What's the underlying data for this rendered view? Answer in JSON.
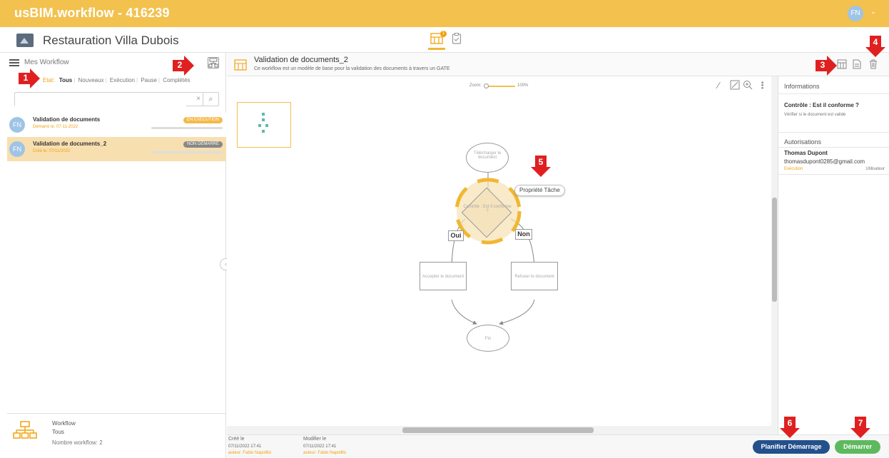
{
  "app": {
    "title": "usBIM.workflow - 416239",
    "user_initials": "FN",
    "user_chevron": "⌄"
  },
  "project": {
    "title": "Restauration Villa Dubois",
    "tabs": [
      {
        "icon": "workflow-tab-icon",
        "badge": "1",
        "active": true
      },
      {
        "icon": "clipboard-tab-icon",
        "active": false
      }
    ]
  },
  "sidebar": {
    "title": "Mes Workflow",
    "filter_state_label": "Etat:",
    "filters": [
      "Tous",
      "Nouveaux",
      "Exécution",
      "Pause",
      "Complétés"
    ],
    "active_filter": "Tous",
    "search": {
      "value": "",
      "placeholder": ""
    },
    "items": [
      {
        "initials": "FN",
        "name": "Validation de documents",
        "date": "Démarré le: 07-11-2022",
        "status": "EN EXÉCUTION",
        "selected": false
      },
      {
        "initials": "FN",
        "name": "Validation de documents_2",
        "date": "Créé le: 07/11/2022",
        "status": "NON DÉMARRÉ",
        "selected": true
      }
    ],
    "footer": {
      "line1": "Workflow",
      "line2": "Tous",
      "line3": "Nombre workflow:  2"
    }
  },
  "detail": {
    "title": "Validation de documents_2",
    "description": "Ce workflow est un modèle de base pour la validation des documents à travers un GATE",
    "zoom_label": "Zoom:",
    "zoom_value": "100%",
    "zoom_level": 1.0
  },
  "diagram": {
    "start_node": "Télécharger le document",
    "decision_node": "Contrôle : Est il conforme ?",
    "yes_label": "Oui",
    "no_label": "Non",
    "accept_node": "Accepter le document",
    "reject_node": "Refuser le document",
    "end_node": "Fin",
    "property_tag": "Propriété Tâche"
  },
  "info": {
    "title": "Informations",
    "task_name": "Contrôle : Est il conforme ?",
    "task_desc": "Vérifier si le document est valide",
    "auth_title": "Autorisations",
    "auth_name": "Thomas Dupont",
    "auth_email": "thomasdupont0285@gmail.com",
    "auth_state": "Exécution",
    "auth_role": "Utilisateur"
  },
  "meta": {
    "created_label": "Créé le",
    "created_value": "07/11/2022 17:41",
    "created_author": "auteur: Fabio Napolillo",
    "modified_label": "Modifier le",
    "modified_value": "07/11/2022 17:41",
    "modified_author": "auteur: Fabio Napolillo"
  },
  "buttons": {
    "plan": "Planifier Démarrage",
    "start": "Démarrer"
  },
  "callouts": [
    "1",
    "2",
    "3",
    "4",
    "5",
    "6",
    "7"
  ],
  "colors": {
    "app_bar": "#f2c14e",
    "accent": "#f2a20f",
    "callout_red": "#e02020",
    "plan_button": "#24508c",
    "start_button": "#5eb95e",
    "selected_row": "#f7dfb0"
  }
}
